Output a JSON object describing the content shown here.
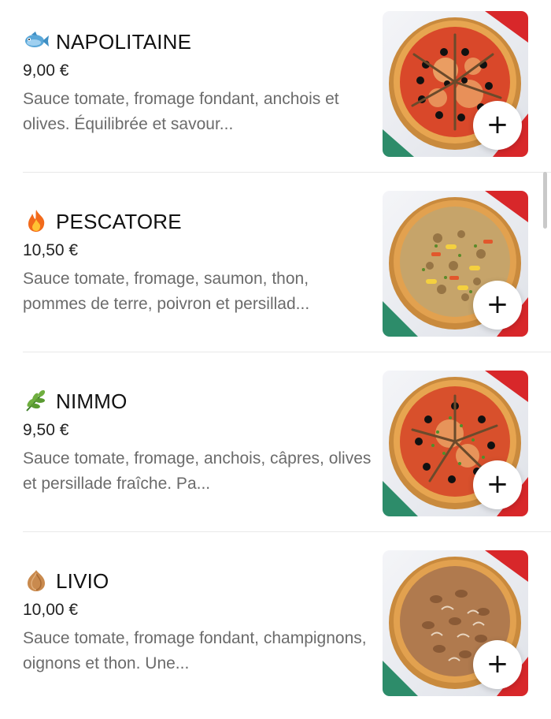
{
  "menu": {
    "items": [
      {
        "emoji": "fish-icon",
        "name": "NAPOLITAINE",
        "price": "9,00 €",
        "description": "Sauce tomate, fromage fondant, anchois et olives. Équilibrée et savour...",
        "add_label": "+"
      },
      {
        "emoji": "fire-icon",
        "name": "PESCATORE",
        "price": "10,50 €",
        "description": "Sauce tomate, fromage, saumon, thon, pommes de terre, poivron et persillad...",
        "add_label": "+"
      },
      {
        "emoji": "herb-icon",
        "name": "NIMMO",
        "price": "9,50 €",
        "description": "Sauce tomate, fromage, anchois, câpres, olives et persillade fraîche. Pa...",
        "add_label": "+"
      },
      {
        "emoji": "onion-icon",
        "name": "LIVIO",
        "price": "10,00 €",
        "description": "Sauce tomate, fromage fondant, champignons, oignons et thon. Une...",
        "add_label": "+"
      }
    ]
  },
  "colors": {
    "title": "#111111",
    "price": "#222222",
    "description": "#6b6b6b",
    "divider": "#e8e8e8",
    "add_button_bg": "#ffffff"
  }
}
